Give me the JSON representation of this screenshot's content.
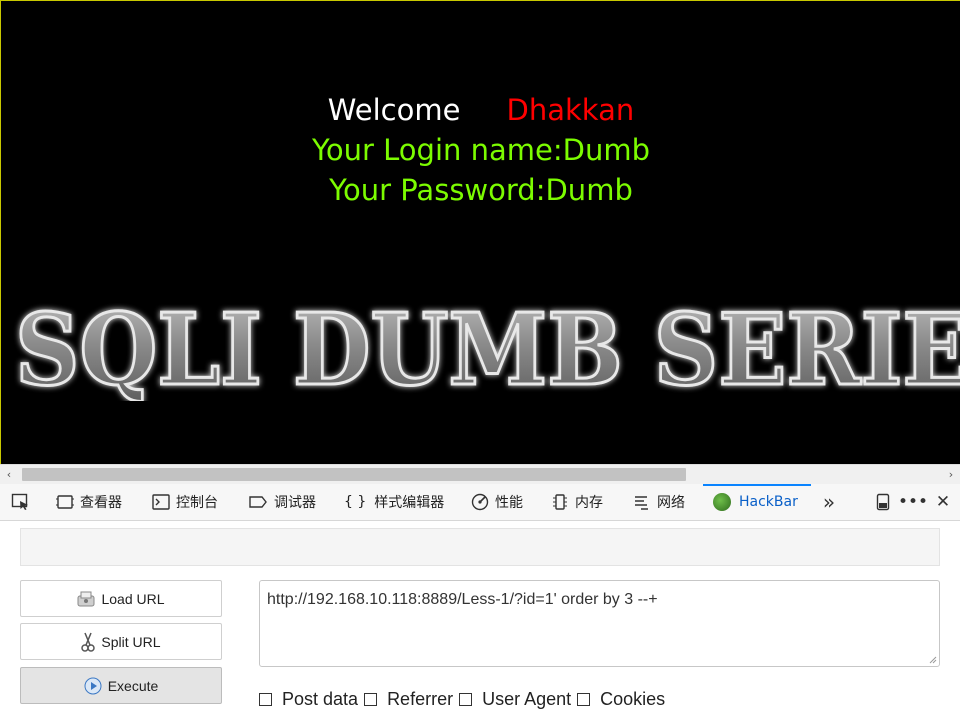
{
  "page": {
    "welcome_word": "Welcome",
    "username": "Dhakkan",
    "login_line": "Your Login name:Dumb",
    "password_line": "Your Password:Dumb",
    "banner_text": "SQLI DUMB SERIES"
  },
  "colors": {
    "background": "#000000",
    "welcome": "#ffffff",
    "username": "#ff0000",
    "info": "#7cfc00",
    "devtools_accent": "#0a84ff"
  },
  "devtools": {
    "tabs": [
      {
        "label": "查看器",
        "icon": "inspector-icon"
      },
      {
        "label": "控制台",
        "icon": "console-icon"
      },
      {
        "label": "调试器",
        "icon": "debugger-icon"
      },
      {
        "label": "样式编辑器",
        "icon": "style-editor-icon"
      },
      {
        "label": "性能",
        "icon": "performance-icon"
      },
      {
        "label": "内存",
        "icon": "memory-icon"
      },
      {
        "label": "网络",
        "icon": "network-icon"
      },
      {
        "label": "HackBar",
        "icon": "hackbar-icon",
        "active": true
      }
    ],
    "overflow_icon": "chevron-double-right-icon"
  },
  "hackbar": {
    "buttons": {
      "load_url": "Load URL",
      "split_url": "Split URL",
      "execute": "Execute"
    },
    "url": "http://192.168.10.118:8889/Less-1/?id=1' order by 3 --+",
    "options": {
      "post_data": "Post data",
      "referrer": "Referrer",
      "user_agent": "User Agent",
      "cookies": "Cookies"
    }
  }
}
